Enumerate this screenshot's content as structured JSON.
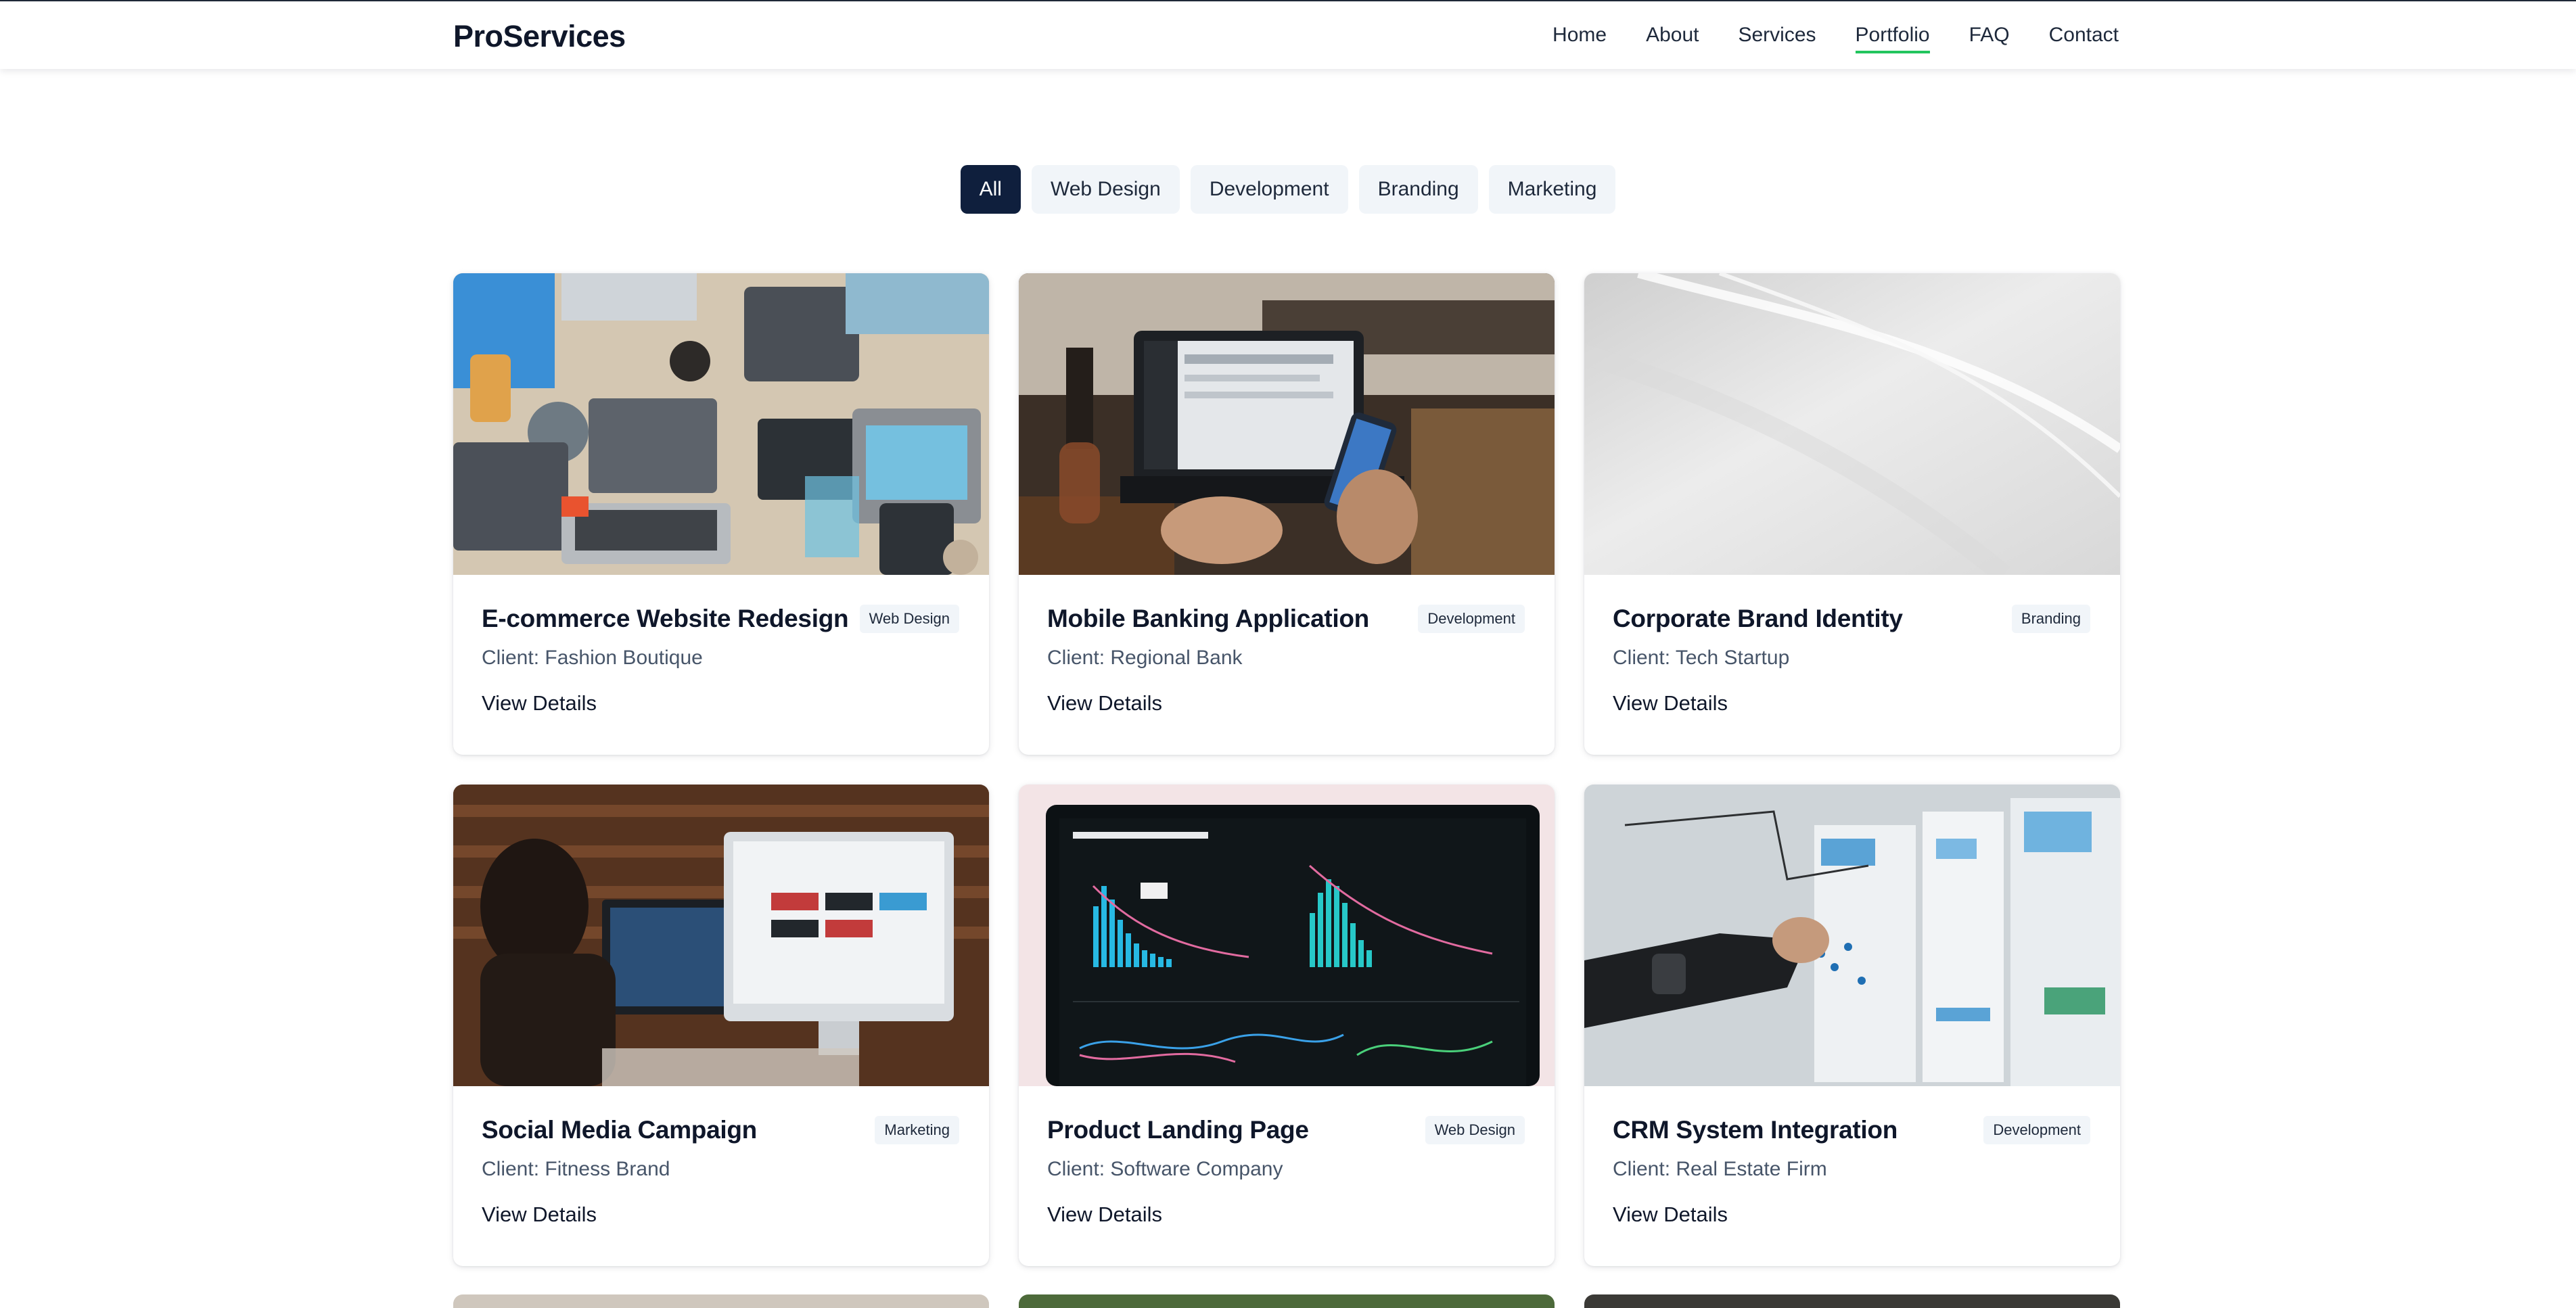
{
  "header": {
    "brand": "ProServices",
    "nav": [
      {
        "label": "Home",
        "active": false
      },
      {
        "label": "About",
        "active": false
      },
      {
        "label": "Services",
        "active": false
      },
      {
        "label": "Portfolio",
        "active": true
      },
      {
        "label": "FAQ",
        "active": false
      },
      {
        "label": "Contact",
        "active": false
      }
    ]
  },
  "filters": [
    {
      "label": "All",
      "active": true
    },
    {
      "label": "Web Design",
      "active": false
    },
    {
      "label": "Development",
      "active": false
    },
    {
      "label": "Branding",
      "active": false
    },
    {
      "label": "Marketing",
      "active": false
    }
  ],
  "projects": [
    {
      "title": "E-commerce Website Redesign",
      "tag": "Web Design",
      "client": "Client: Fashion Boutique",
      "cta": "View Details"
    },
    {
      "title": "Mobile Banking Application",
      "tag": "Development",
      "client": "Client: Regional Bank",
      "cta": "View Details"
    },
    {
      "title": "Corporate Brand Identity",
      "tag": "Branding",
      "client": "Client: Tech Startup",
      "cta": "View Details"
    },
    {
      "title": "Social Media Campaign",
      "tag": "Marketing",
      "client": "Client: Fitness Brand",
      "cta": "View Details"
    },
    {
      "title": "Product Landing Page",
      "tag": "Web Design",
      "client": "Client: Software Company",
      "cta": "View Details"
    },
    {
      "title": "CRM System Integration",
      "tag": "Development",
      "client": "Client: Real Estate Firm",
      "cta": "View Details"
    }
  ]
}
